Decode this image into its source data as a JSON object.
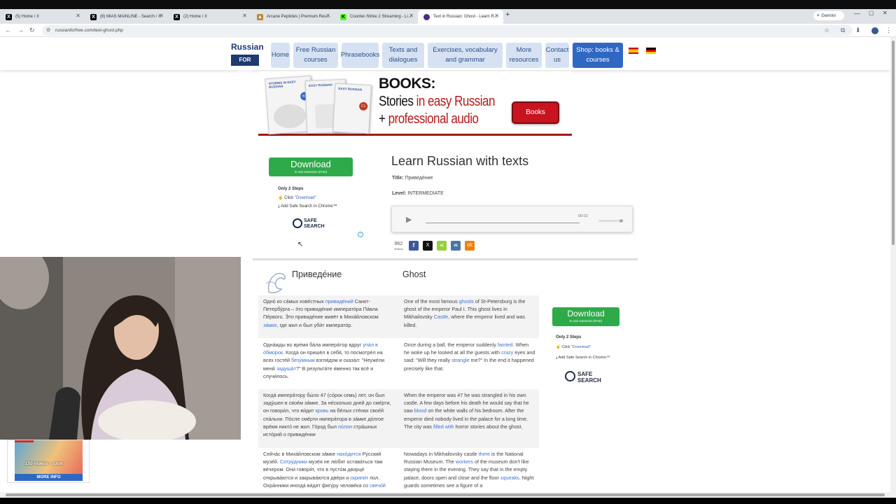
{
  "browser": {
    "tabs": [
      {
        "title": "(5) Home / X",
        "favicon": "x-logo"
      },
      {
        "title": "(8) MIAS MAINLINE - Search / X",
        "favicon": "x-logo"
      },
      {
        "title": "(2) Home / X",
        "favicon": "x-logo"
      },
      {
        "title": "Arcane Peptides | Premium Res...",
        "favicon": "arcane-logo"
      },
      {
        "title": "Counter-Strike 2 Streaming - Li...",
        "favicon": "kick-logo"
      },
      {
        "title": "Text in Russian: Ghost - Learn R...",
        "favicon": "site-logo"
      }
    ],
    "new_tab": "+",
    "gemini_label": "Gemini",
    "url": "russianforfree.com/text-ghost.php"
  },
  "site": {
    "logo_top": "Russian",
    "logo_bottom": "FOR FREE",
    "nav": [
      {
        "label": "Home"
      },
      {
        "label": "Free Russian courses"
      },
      {
        "label": "Phrasebooks"
      },
      {
        "label": "Texts and dialogues"
      },
      {
        "label": "Exercises, vocabulary and grammar"
      },
      {
        "label": "More resources"
      },
      {
        "label": "Contact us"
      },
      {
        "label": "Shop: books & courses"
      }
    ],
    "flags": [
      "spanish-flag",
      "german-flag"
    ]
  },
  "banner": {
    "heading": "BOOKS:",
    "line1_a": "Stories ",
    "line1_b": "in easy Russian",
    "line2_a": "+ ",
    "line2_b": "professional audio",
    "button": "Books",
    "book_labels": [
      "STORIES IN EASY RUSSIAN",
      "EASY RUSSIAN",
      "EASY RUSSIAN"
    ],
    "levels": [
      "B1",
      "A2",
      "C1"
    ]
  },
  "ad": {
    "download": "Download",
    "download_sub": "to use extension (Free)",
    "steps_title": "Only 2 Steps",
    "step1_a": "Click ",
    "step1_b": "\"Download\"",
    "step2": "Add Safe Search in Chrome™",
    "brand_top": "SAFE",
    "brand_bottom": "SEARCH",
    "info_icon": "i"
  },
  "lesson": {
    "page_title": "Learn Russian with texts",
    "title_label": "Title:",
    "title_value": "Приведе́ние",
    "level_label": "Level:",
    "level_value": "INTERMEDIATE",
    "audio_time": "00:02",
    "share_count": "962",
    "share_label": "Shares",
    "col_ru_title": "Приведе́ние",
    "col_en_title": "Ghost"
  },
  "paragraphs": [
    {
      "ru": [
        {
          "t": "Одно́ из са́мых изве́стных "
        },
        {
          "t": "привиде́ний",
          "l": 1
        },
        {
          "t": " Санкт-Петербу́рга – э́то привиде́ние императо́ра Па́вла Пе́рвого. Э́то привиде́ние живёт в Миха́йловском "
        },
        {
          "t": "за́мке",
          "l": 1
        },
        {
          "t": ", где жил и был уби́т императо́р."
        }
      ],
      "en": [
        {
          "t": "One of the most famous "
        },
        {
          "t": "ghosts",
          "l": 1
        },
        {
          "t": " of St-Petersburg is the ghost of the emperor Paul I. This ghost lives in Mikhailovsky "
        },
        {
          "t": "Castle",
          "l": 1
        },
        {
          "t": ", where the emperor lived and was killed."
        }
      ]
    },
    {
      "ru": [
        {
          "t": "Одна́жды во вре́мя ба́ла импера́тор вдруг "
        },
        {
          "t": "упа́л в о́бморок",
          "l": 1
        },
        {
          "t": ". Когда́ он пришёл в себя́, то посмотре́л на всех госте́й "
        },
        {
          "t": "безу́мным",
          "l": 1
        },
        {
          "t": " взгля́дом и сказа́л: \"Неуже́ли меня́ "
        },
        {
          "t": "задуша́т",
          "l": 1
        },
        {
          "t": "?\" В результа́те и́менно так всё и случи́лось."
        }
      ],
      "en": [
        {
          "t": "Once during a ball, the emperor suddenly "
        },
        {
          "t": "fainted",
          "l": 1
        },
        {
          "t": ". When he woke up he looked at all the guests with "
        },
        {
          "t": "crazy",
          "l": 1
        },
        {
          "t": " eyes and said: \"Will they really "
        },
        {
          "t": "strangle",
          "l": 1
        },
        {
          "t": " me?\" In the end it happened precisely like that."
        }
      ]
    },
    {
      "ru": [
        {
          "t": "Когда́ импера́тору бы́ло 47 (со́рок семь) лет, он был заду́шен в свое́м за́мке. За не́сколько дней до сме́рти, он говори́л, что ви́дит "
        },
        {
          "t": "кровь",
          "l": 1
        },
        {
          "t": " на бе́лых сте́нах свое́й спа́льни. По́сле сме́рти импера́тора в за́мке до́лгое вре́мя никто́ не жил. Го́род был "
        },
        {
          "t": "по́лон",
          "l": 1
        },
        {
          "t": " стра́шных исто́рий о привиде́нии"
        }
      ],
      "en": [
        {
          "t": "When the emperor was 47 he was strangled in his own castle. A few days before his death he would say that he saw "
        },
        {
          "t": "blood",
          "l": 1
        },
        {
          "t": " on the white walls of his bedroom. After the emperor died nobody lived in the palace for a long time. The city was "
        },
        {
          "t": "filled with",
          "l": 1
        },
        {
          "t": " horror stories about the ghost."
        }
      ]
    },
    {
      "ru": [
        {
          "t": "Сейча́с в Миха́йловском за́мке "
        },
        {
          "t": "нахо́дится",
          "l": 1
        },
        {
          "t": " Ру́сский музе́й. "
        },
        {
          "t": "Сотру́дники",
          "l": 1
        },
        {
          "t": " музе́я не лю́бят остава́ться там ве́чером. Они́ говоря́т, что в пусто́м дворце́ открыва́ются и закрыва́ются две́ри и "
        },
        {
          "t": "скрипи́т",
          "l": 1
        },
        {
          "t": " пол. Охра́нники иногда́ ви́дят фигу́ру челове́ка со "
        },
        {
          "t": "свечо́й",
          "l": 1
        }
      ],
      "en": [
        {
          "t": "Nowadays in Mikhailovsky castle "
        },
        {
          "t": "there",
          "l": 1
        },
        {
          "t": " is the National Russian Museum. The "
        },
        {
          "t": "workers",
          "l": 1
        },
        {
          "t": " of the museum don't like staying there in the evening. They say that in the empty palace, doors open and close and the floor "
        },
        {
          "t": "squeaks",
          "l": 1
        },
        {
          "t": ". Night guards sometimes see a figure of a"
        }
      ]
    }
  ],
  "promo": {
    "videos_label": "150 videos - tutor",
    "more_info": "MORE INFO"
  },
  "colors": {
    "nav_bg": "#d6e2f3",
    "nav_text": "#2a4f86",
    "shop_bg": "#2f68c2",
    "download_green": "#2eaa4a",
    "link_blue": "#3d72d6",
    "banner_red": "#a01a1a"
  }
}
